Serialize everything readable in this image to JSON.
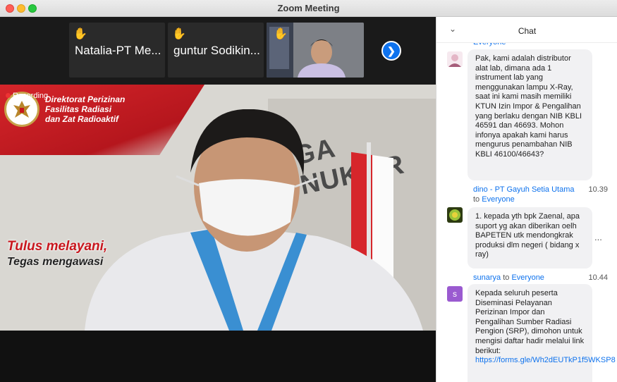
{
  "window": {
    "title": "Zoom Meeting"
  },
  "participants": [
    {
      "name": "Natalia-PT Me..."
    },
    {
      "name": "guntur Sodikin..."
    }
  ],
  "video": {
    "recording": "Recording",
    "org_line1": "Direktorat Perizinan",
    "org_line2": "Fasilitas Radiasi",
    "org_line3": "dan Zat Radioaktif",
    "logo_text": "BAPETEN",
    "wall_text": "GA NUKLIR",
    "slogan1": "Tulus melayani,",
    "slogan2": "Tegas mengawasi"
  },
  "chat": {
    "title": "Chat",
    "top_recipient": "Everyone",
    "messages": [
      {
        "text": "Pak, kami adalah distributor alat lab, dimana ada 1 instrument lab yang menggunakan lampu X-Ray, saat ini kami masih memiliki KTUN Izin Impor & Pengalihan yang berlaku dengan NIB KBLI 46591 dan 46693. Mohon infonya apakah kami harus mengurus penambahan NIB KBLI 46100/46643?"
      },
      {
        "sender": "dino - PT Gayuh Setia Utama",
        "to": "to",
        "recipient": "Everyone",
        "time": "10.39",
        "text": "1. kepada yth bpk Zaenal, apa suport yg akan diberikan oelh BAPETEN utk mendongkrak produksi dlm negeri ( bidang x ray)"
      },
      {
        "sender": "sunarya",
        "to": "to",
        "recipient": "Everyone",
        "time": "10.44",
        "avatar_letter": "s",
        "text": "Kepada seluruh peserta Diseminasi Pelayanan Perizinan Impor dan Pengalihan Sumber Radiasi Pengion (SRP), dimohon untuk mengisi daftar hadir melalui link berikut:",
        "link": "https://forms.gle/Wh2dEUTkP1f5WKSP8"
      }
    ],
    "more_icon": "..."
  },
  "colors": {
    "accent": "#0e72ed",
    "banner_red": "#c8161d"
  }
}
